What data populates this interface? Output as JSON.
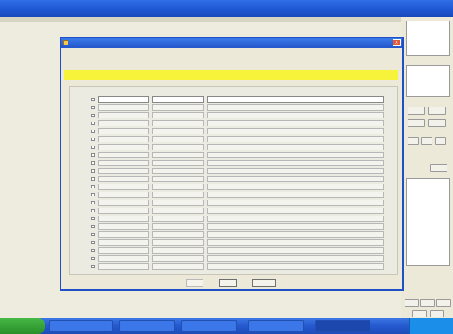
{
  "main_window": {
    "title": ""
  },
  "dialog": {
    "title": "",
    "headers": [
      "",
      "",
      ""
    ],
    "yellow_row": {
      "label": "",
      "c1": "",
      "c2": "",
      "c3": ""
    },
    "rows": [
      {
        "n": "",
        "c1": "",
        "c2": "",
        "c3": ""
      },
      {
        "n": "",
        "c1": "",
        "c2": "",
        "c3": ""
      },
      {
        "n": "",
        "c1": "",
        "c2": "",
        "c3": ""
      },
      {
        "n": "",
        "c1": "",
        "c2": "",
        "c3": ""
      },
      {
        "n": "",
        "c1": "",
        "c2": "",
        "c3": ""
      },
      {
        "n": "",
        "c1": "",
        "c2": "",
        "c3": ""
      },
      {
        "n": "",
        "c1": "",
        "c2": "",
        "c3": ""
      },
      {
        "n": "",
        "c1": "",
        "c2": "",
        "c3": ""
      },
      {
        "n": "",
        "c1": "",
        "c2": "",
        "c3": ""
      },
      {
        "n": "",
        "c1": "",
        "c2": "",
        "c3": ""
      },
      {
        "n": "",
        "c1": "",
        "c2": "",
        "c3": ""
      },
      {
        "n": "",
        "c1": "",
        "c2": "",
        "c3": ""
      },
      {
        "n": "",
        "c1": "",
        "c2": "",
        "c3": ""
      },
      {
        "n": "",
        "c1": "",
        "c2": "",
        "c3": ""
      },
      {
        "n": "",
        "c1": "",
        "c2": "",
        "c3": ""
      },
      {
        "n": "",
        "c1": "",
        "c2": "",
        "c3": ""
      },
      {
        "n": "",
        "c1": "",
        "c2": "",
        "c3": ""
      },
      {
        "n": "",
        "c1": "",
        "c2": "",
        "c3": ""
      },
      {
        "n": "",
        "c1": "",
        "c2": "",
        "c3": ""
      },
      {
        "n": "",
        "c1": "",
        "c2": "",
        "c3": ""
      },
      {
        "n": "",
        "c1": "",
        "c2": "",
        "c3": ""
      },
      {
        "n": "",
        "c1": "",
        "c2": "",
        "c3": ""
      }
    ],
    "buttons": {
      "b1": "",
      "b2": "",
      "b3": ""
    }
  },
  "right_panel": {
    "labels": [
      "",
      "",
      "",
      "",
      "",
      ""
    ]
  },
  "taskbar": {
    "start": "",
    "items": [
      "",
      "",
      "",
      "",
      ""
    ],
    "clock": ""
  },
  "colors": {
    "titlebar": "#1d55d0",
    "highlight_row": "#f7f23a",
    "taskbar": "#2558cf",
    "start_button": "#2a8f2a"
  }
}
